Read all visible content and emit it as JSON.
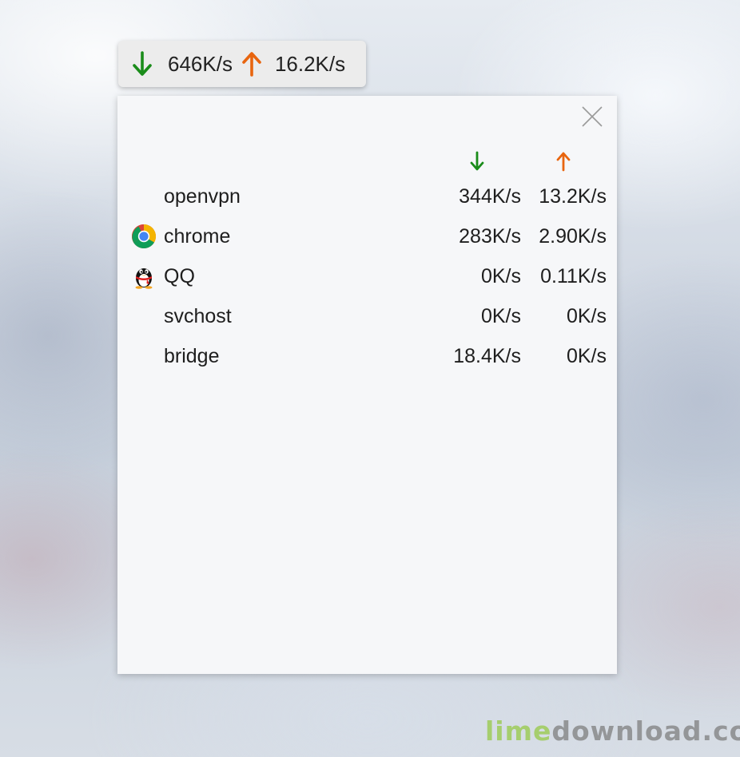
{
  "speed_bar": {
    "download": "646K/s",
    "upload": "16.2K/s",
    "download_icon": "download-arrow-icon",
    "upload_icon": "upload-arrow-icon"
  },
  "panel": {
    "close_icon": "close-icon",
    "column_icons": [
      "download-arrow-icon",
      "upload-arrow-icon"
    ],
    "processes": [
      {
        "name": "openvpn",
        "icon": "",
        "download": "344K/s",
        "upload": "13.2K/s"
      },
      {
        "name": "chrome",
        "icon": "chrome-icon",
        "download": "283K/s",
        "upload": "2.90K/s"
      },
      {
        "name": "QQ",
        "icon": "qq-penguin-icon",
        "download": "0K/s",
        "upload": "0.11K/s"
      },
      {
        "name": "svchost",
        "icon": "",
        "download": "0K/s",
        "upload": "0K/s"
      },
      {
        "name": "bridge",
        "icon": "",
        "download": "18.4K/s",
        "upload": "0K/s"
      }
    ]
  },
  "colors": {
    "download": "#1a8c1a",
    "upload": "#e8650f",
    "panel_bg": "#f6f7f9"
  },
  "watermark": {
    "part1": "lime",
    "part2": "download.com"
  }
}
